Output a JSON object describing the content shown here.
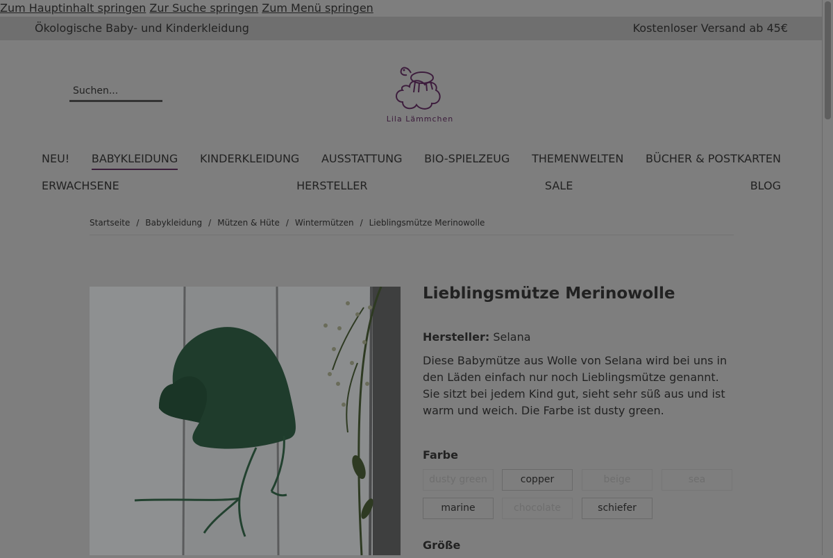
{
  "skip_links": [
    "Zum Hauptinhalt springen",
    "Zur Suche springen",
    "Zum Menü springen"
  ],
  "topbar": {
    "left": "Ökologische Baby- und Kinderkleidung",
    "right": "Kostenloser Versand ab 45€"
  },
  "search": {
    "placeholder": "Suchen..."
  },
  "logo": {
    "name": "Lila Lämmchen",
    "icon": "lamb-on-cloud-logo"
  },
  "nav": {
    "row1": [
      "NEU!",
      "BABYKLEIDUNG",
      "KINDERKLEIDUNG",
      "AUSSTATTUNG",
      "BIO-SPIELZEUG",
      "THEMENWELTEN",
      "BÜCHER & POSTKARTEN"
    ],
    "row2": [
      "ERWACHSENE",
      "HERSTELLER",
      "SALE",
      "BLOG"
    ],
    "active": "BABYKLEIDUNG"
  },
  "breadcrumb": [
    "Startseite",
    "Babykleidung",
    "Mützen & Hüte",
    "Wintermützen",
    "Lieblingsmütze Merinowolle"
  ],
  "product": {
    "title": "Lieblingsmütze Merinowolle",
    "maker_label": "Hersteller:",
    "maker": "Selana",
    "description": "Diese Babymütze aus Wolle von Selana wird bei uns in den Läden einfach nur noch Lieblingsmütze genannt. Sie sitzt bei jedem Kind gut, sieht sehr süß aus und ist warm und weich. Die Farbe ist dusty green.",
    "color_label": "Farbe",
    "colors": [
      {
        "label": "dusty green",
        "available": false
      },
      {
        "label": "copper",
        "available": true
      },
      {
        "label": "beige",
        "available": false
      },
      {
        "label": "sea",
        "available": false
      },
      {
        "label": "marine",
        "available": true
      },
      {
        "label": "chocolate",
        "available": false
      },
      {
        "label": "schiefer",
        "available": true
      }
    ],
    "size_label": "Größe"
  },
  "colors": {
    "overlay_bg": "#7e7e7e",
    "accent": "#3a1f3a"
  }
}
